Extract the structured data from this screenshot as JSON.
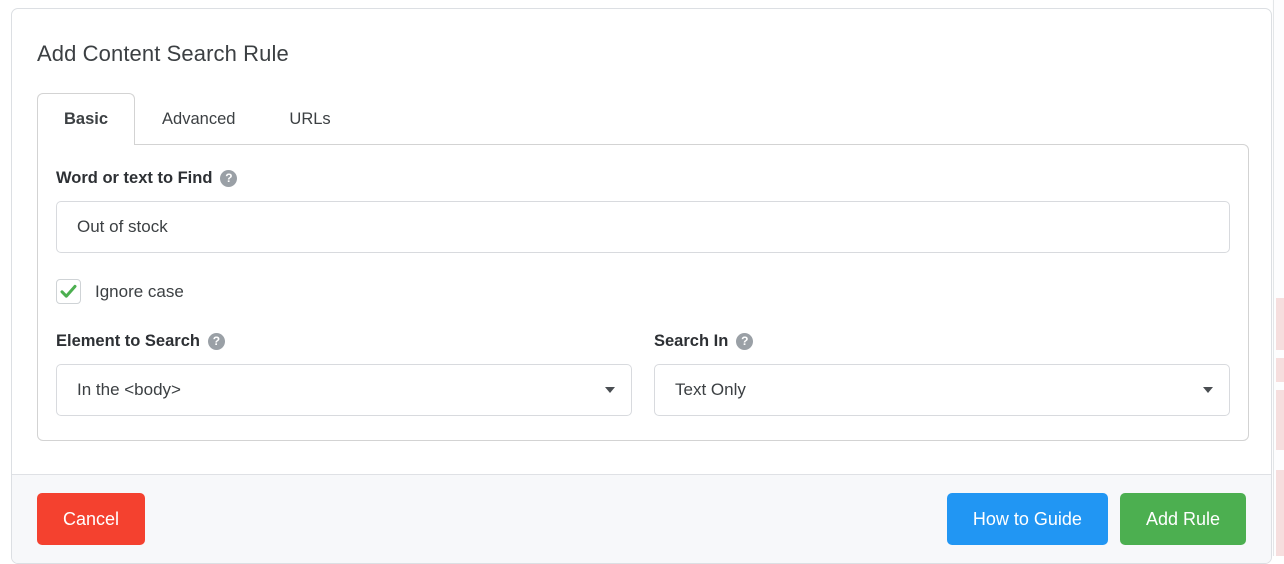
{
  "modal": {
    "title": "Add Content Search Rule"
  },
  "tabs": [
    {
      "label": "Basic",
      "active": true
    },
    {
      "label": "Advanced",
      "active": false
    },
    {
      "label": "URLs",
      "active": false
    }
  ],
  "form": {
    "word_or_text": {
      "label": "Word or text to Find",
      "help_icon": "help-circle-icon",
      "value": "Out of stock",
      "placeholder": ""
    },
    "ignore_case": {
      "label": "Ignore case",
      "checked": true,
      "check_glyph": "✔",
      "check_color": "#4caf50"
    },
    "element_to_search": {
      "label": "Element to Search",
      "help_icon": "help-circle-icon",
      "value": "In the <body>"
    },
    "search_in": {
      "label": "Search In",
      "help_icon": "help-circle-icon",
      "value": "Text Only"
    },
    "help_glyph": "?"
  },
  "footer": {
    "cancel_label": "Cancel",
    "guide_label": "How to Guide",
    "add_label": "Add Rule",
    "cancel_color": "#f4412f",
    "guide_color": "#2196f3",
    "add_color": "#4caf50"
  }
}
